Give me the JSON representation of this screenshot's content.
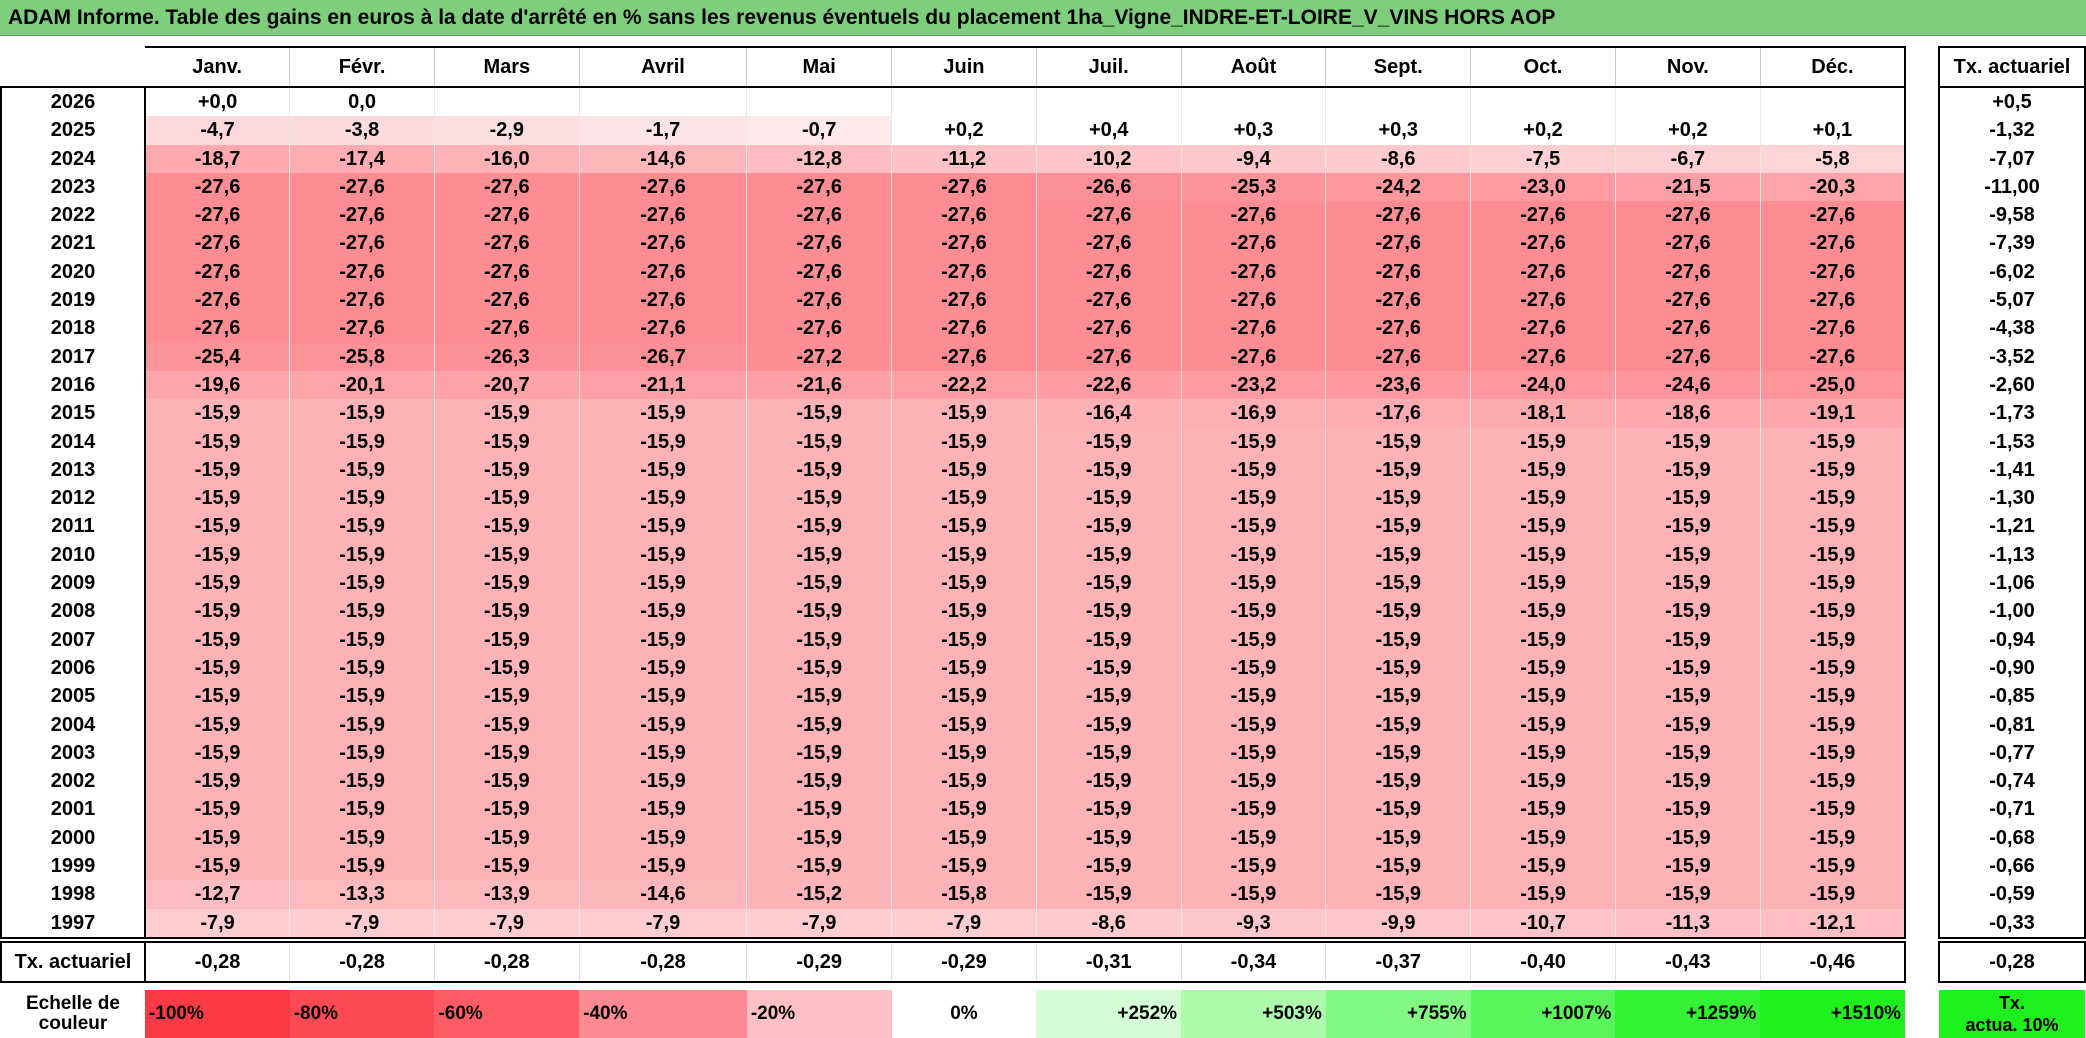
{
  "title": "ADAM Informe. Table des gains en euros à la date d'arrêté en % sans les revenus éventuels du placement 1ha_Vigne_INDRE-ET-LOIRE_V_VINS HORS AOP",
  "months": [
    "Janv.",
    "Févr.",
    "Mars",
    "Avril",
    "Mai",
    "Juin",
    "Juil.",
    "Août",
    "Sept.",
    "Oct.",
    "Nov.",
    "Déc."
  ],
  "rate_header": "Tx. actuariel",
  "rows": [
    {
      "year": "2026",
      "values": [
        "+0,0",
        "0,0",
        "",
        "",
        "",
        "",
        "",
        "",
        "",
        "",
        "",
        ""
      ],
      "rate": "+0,5"
    },
    {
      "year": "2025",
      "values": [
        "-4,7",
        "-3,8",
        "-2,9",
        "-1,7",
        "-0,7",
        "+0,2",
        "+0,4",
        "+0,3",
        "+0,3",
        "+0,2",
        "+0,2",
        "+0,1"
      ],
      "rate": "-1,32"
    },
    {
      "year": "2024",
      "values": [
        "-18,7",
        "-17,4",
        "-16,0",
        "-14,6",
        "-12,8",
        "-11,2",
        "-10,2",
        "-9,4",
        "-8,6",
        "-7,5",
        "-6,7",
        "-5,8"
      ],
      "rate": "-7,07"
    },
    {
      "year": "2023",
      "values": [
        "-27,6",
        "-27,6",
        "-27,6",
        "-27,6",
        "-27,6",
        "-27,6",
        "-26,6",
        "-25,3",
        "-24,2",
        "-23,0",
        "-21,5",
        "-20,3"
      ],
      "rate": "-11,00"
    },
    {
      "year": "2022",
      "values": [
        "-27,6",
        "-27,6",
        "-27,6",
        "-27,6",
        "-27,6",
        "-27,6",
        "-27,6",
        "-27,6",
        "-27,6",
        "-27,6",
        "-27,6",
        "-27,6"
      ],
      "rate": "-9,58"
    },
    {
      "year": "2021",
      "values": [
        "-27,6",
        "-27,6",
        "-27,6",
        "-27,6",
        "-27,6",
        "-27,6",
        "-27,6",
        "-27,6",
        "-27,6",
        "-27,6",
        "-27,6",
        "-27,6"
      ],
      "rate": "-7,39"
    },
    {
      "year": "2020",
      "values": [
        "-27,6",
        "-27,6",
        "-27,6",
        "-27,6",
        "-27,6",
        "-27,6",
        "-27,6",
        "-27,6",
        "-27,6",
        "-27,6",
        "-27,6",
        "-27,6"
      ],
      "rate": "-6,02"
    },
    {
      "year": "2019",
      "values": [
        "-27,6",
        "-27,6",
        "-27,6",
        "-27,6",
        "-27,6",
        "-27,6",
        "-27,6",
        "-27,6",
        "-27,6",
        "-27,6",
        "-27,6",
        "-27,6"
      ],
      "rate": "-5,07"
    },
    {
      "year": "2018",
      "values": [
        "-27,6",
        "-27,6",
        "-27,6",
        "-27,6",
        "-27,6",
        "-27,6",
        "-27,6",
        "-27,6",
        "-27,6",
        "-27,6",
        "-27,6",
        "-27,6"
      ],
      "rate": "-4,38"
    },
    {
      "year": "2017",
      "values": [
        "-25,4",
        "-25,8",
        "-26,3",
        "-26,7",
        "-27,2",
        "-27,6",
        "-27,6",
        "-27,6",
        "-27,6",
        "-27,6",
        "-27,6",
        "-27,6"
      ],
      "rate": "-3,52"
    },
    {
      "year": "2016",
      "values": [
        "-19,6",
        "-20,1",
        "-20,7",
        "-21,1",
        "-21,6",
        "-22,2",
        "-22,6",
        "-23,2",
        "-23,6",
        "-24,0",
        "-24,6",
        "-25,0"
      ],
      "rate": "-2,60"
    },
    {
      "year": "2015",
      "values": [
        "-15,9",
        "-15,9",
        "-15,9",
        "-15,9",
        "-15,9",
        "-15,9",
        "-16,4",
        "-16,9",
        "-17,6",
        "-18,1",
        "-18,6",
        "-19,1"
      ],
      "rate": "-1,73"
    },
    {
      "year": "2014",
      "values": [
        "-15,9",
        "-15,9",
        "-15,9",
        "-15,9",
        "-15,9",
        "-15,9",
        "-15,9",
        "-15,9",
        "-15,9",
        "-15,9",
        "-15,9",
        "-15,9"
      ],
      "rate": "-1,53"
    },
    {
      "year": "2013",
      "values": [
        "-15,9",
        "-15,9",
        "-15,9",
        "-15,9",
        "-15,9",
        "-15,9",
        "-15,9",
        "-15,9",
        "-15,9",
        "-15,9",
        "-15,9",
        "-15,9"
      ],
      "rate": "-1,41"
    },
    {
      "year": "2012",
      "values": [
        "-15,9",
        "-15,9",
        "-15,9",
        "-15,9",
        "-15,9",
        "-15,9",
        "-15,9",
        "-15,9",
        "-15,9",
        "-15,9",
        "-15,9",
        "-15,9"
      ],
      "rate": "-1,30"
    },
    {
      "year": "2011",
      "values": [
        "-15,9",
        "-15,9",
        "-15,9",
        "-15,9",
        "-15,9",
        "-15,9",
        "-15,9",
        "-15,9",
        "-15,9",
        "-15,9",
        "-15,9",
        "-15,9"
      ],
      "rate": "-1,21"
    },
    {
      "year": "2010",
      "values": [
        "-15,9",
        "-15,9",
        "-15,9",
        "-15,9",
        "-15,9",
        "-15,9",
        "-15,9",
        "-15,9",
        "-15,9",
        "-15,9",
        "-15,9",
        "-15,9"
      ],
      "rate": "-1,13"
    },
    {
      "year": "2009",
      "values": [
        "-15,9",
        "-15,9",
        "-15,9",
        "-15,9",
        "-15,9",
        "-15,9",
        "-15,9",
        "-15,9",
        "-15,9",
        "-15,9",
        "-15,9",
        "-15,9"
      ],
      "rate": "-1,06"
    },
    {
      "year": "2008",
      "values": [
        "-15,9",
        "-15,9",
        "-15,9",
        "-15,9",
        "-15,9",
        "-15,9",
        "-15,9",
        "-15,9",
        "-15,9",
        "-15,9",
        "-15,9",
        "-15,9"
      ],
      "rate": "-1,00"
    },
    {
      "year": "2007",
      "values": [
        "-15,9",
        "-15,9",
        "-15,9",
        "-15,9",
        "-15,9",
        "-15,9",
        "-15,9",
        "-15,9",
        "-15,9",
        "-15,9",
        "-15,9",
        "-15,9"
      ],
      "rate": "-0,94"
    },
    {
      "year": "2006",
      "values": [
        "-15,9",
        "-15,9",
        "-15,9",
        "-15,9",
        "-15,9",
        "-15,9",
        "-15,9",
        "-15,9",
        "-15,9",
        "-15,9",
        "-15,9",
        "-15,9"
      ],
      "rate": "-0,90"
    },
    {
      "year": "2005",
      "values": [
        "-15,9",
        "-15,9",
        "-15,9",
        "-15,9",
        "-15,9",
        "-15,9",
        "-15,9",
        "-15,9",
        "-15,9",
        "-15,9",
        "-15,9",
        "-15,9"
      ],
      "rate": "-0,85"
    },
    {
      "year": "2004",
      "values": [
        "-15,9",
        "-15,9",
        "-15,9",
        "-15,9",
        "-15,9",
        "-15,9",
        "-15,9",
        "-15,9",
        "-15,9",
        "-15,9",
        "-15,9",
        "-15,9"
      ],
      "rate": "-0,81"
    },
    {
      "year": "2003",
      "values": [
        "-15,9",
        "-15,9",
        "-15,9",
        "-15,9",
        "-15,9",
        "-15,9",
        "-15,9",
        "-15,9",
        "-15,9",
        "-15,9",
        "-15,9",
        "-15,9"
      ],
      "rate": "-0,77"
    },
    {
      "year": "2002",
      "values": [
        "-15,9",
        "-15,9",
        "-15,9",
        "-15,9",
        "-15,9",
        "-15,9",
        "-15,9",
        "-15,9",
        "-15,9",
        "-15,9",
        "-15,9",
        "-15,9"
      ],
      "rate": "-0,74"
    },
    {
      "year": "2001",
      "values": [
        "-15,9",
        "-15,9",
        "-15,9",
        "-15,9",
        "-15,9",
        "-15,9",
        "-15,9",
        "-15,9",
        "-15,9",
        "-15,9",
        "-15,9",
        "-15,9"
      ],
      "rate": "-0,71"
    },
    {
      "year": "2000",
      "values": [
        "-15,9",
        "-15,9",
        "-15,9",
        "-15,9",
        "-15,9",
        "-15,9",
        "-15,9",
        "-15,9",
        "-15,9",
        "-15,9",
        "-15,9",
        "-15,9"
      ],
      "rate": "-0,68"
    },
    {
      "year": "1999",
      "values": [
        "-15,9",
        "-15,9",
        "-15,9",
        "-15,9",
        "-15,9",
        "-15,9",
        "-15,9",
        "-15,9",
        "-15,9",
        "-15,9",
        "-15,9",
        "-15,9"
      ],
      "rate": "-0,66"
    },
    {
      "year": "1998",
      "values": [
        "-12,7",
        "-13,3",
        "-13,9",
        "-14,6",
        "-15,2",
        "-15,8",
        "-15,9",
        "-15,9",
        "-15,9",
        "-15,9",
        "-15,9",
        "-15,9"
      ],
      "rate": "-0,59"
    },
    {
      "year": "1997",
      "values": [
        "-7,9",
        "-7,9",
        "-7,9",
        "-7,9",
        "-7,9",
        "-7,9",
        "-8,6",
        "-9,3",
        "-9,9",
        "-10,7",
        "-11,3",
        "-12,1"
      ],
      "rate": "-0,33"
    }
  ],
  "summary": {
    "label": "Tx. actuariel",
    "values": [
      "-0,28",
      "-0,28",
      "-0,28",
      "-0,28",
      "-0,29",
      "-0,29",
      "-0,31",
      "-0,34",
      "-0,37",
      "-0,40",
      "-0,43",
      "-0,46"
    ],
    "rate": "-0,28"
  },
  "scale": {
    "label_line1": "Echelle de",
    "label_line2": "couleur",
    "steps": [
      {
        "text": "-100%",
        "color": "#fc3a46",
        "kind": "neg"
      },
      {
        "text": "-80%",
        "color": "#fc4a55",
        "kind": "neg"
      },
      {
        "text": "-60%",
        "color": "#fd5c66",
        "kind": "neg"
      },
      {
        "text": "-40%",
        "color": "#fd8a92",
        "kind": "neg"
      },
      {
        "text": "-20%",
        "color": "#fec0c5",
        "kind": "neg"
      },
      {
        "text": "0%",
        "color": "#ffffff",
        "kind": "zero"
      },
      {
        "text": "+252%",
        "color": "#d5fdd5",
        "kind": "pos"
      },
      {
        "text": "+503%",
        "color": "#abfbab",
        "kind": "pos"
      },
      {
        "text": "+755%",
        "color": "#82f982",
        "kind": "pos"
      },
      {
        "text": "+1007%",
        "color": "#5af55a",
        "kind": "pos"
      },
      {
        "text": "+1259%",
        "color": "#33f233",
        "kind": "pos"
      },
      {
        "text": "+1510%",
        "color": "#1ef01e",
        "kind": "pos"
      }
    ],
    "rate_line1": "Tx.",
    "rate_line2": "actua. 10%",
    "rate_color": "#1ef01e"
  },
  "colors": {
    "title_bg": "#7ece7e",
    "neg_full": "#fd8d93",
    "neg_light": "#fde7e8"
  }
}
